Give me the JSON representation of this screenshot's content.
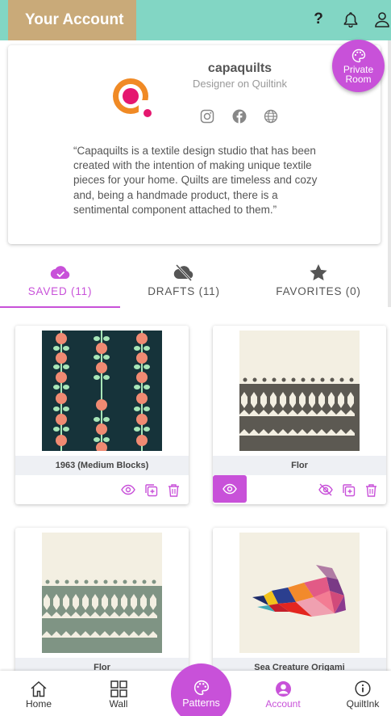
{
  "header": {
    "title": "Your Account",
    "help_label": "?",
    "icons": [
      "help-icon",
      "bell-icon",
      "user-icon"
    ]
  },
  "profile": {
    "username": "capaquilts",
    "subtitle": "Designer on Quiltink",
    "bio": "“Capaquilts is a textile design studio that has been created with the intention of making unique textile pieces for your home. Quilts are timeless and cozy and, being a handmade product, there is a sentimental component attached to them.”",
    "social_icons": [
      "instagram-icon",
      "facebook-icon",
      "globe-icon"
    ]
  },
  "private_room": {
    "line1": "Private",
    "line2": "Room"
  },
  "tabs": [
    {
      "label": "SAVED (11)",
      "icon": "cloud-check-icon",
      "active": true
    },
    {
      "label": "DRAFTS (11)",
      "icon": "cloud-off-icon",
      "active": false
    },
    {
      "label": "FAVORITES (0)",
      "icon": "star-icon",
      "active": false
    }
  ],
  "patterns": [
    {
      "name": "1963 (Medium Blocks)"
    },
    {
      "name": "Flor"
    },
    {
      "name": "Flor"
    },
    {
      "name": "Sea Creature Origami"
    }
  ],
  "bottom_nav": {
    "home": "Home",
    "wall": "Wall",
    "patterns": "Patterns",
    "account": "Account",
    "quiltink": "QuiltInk"
  },
  "colors": {
    "accent": "#c851d9",
    "header_bg": "#82d6c4",
    "title_bg": "#c9aa79",
    "logo_orange": "#f08a25",
    "logo_pink": "#e5176f"
  }
}
